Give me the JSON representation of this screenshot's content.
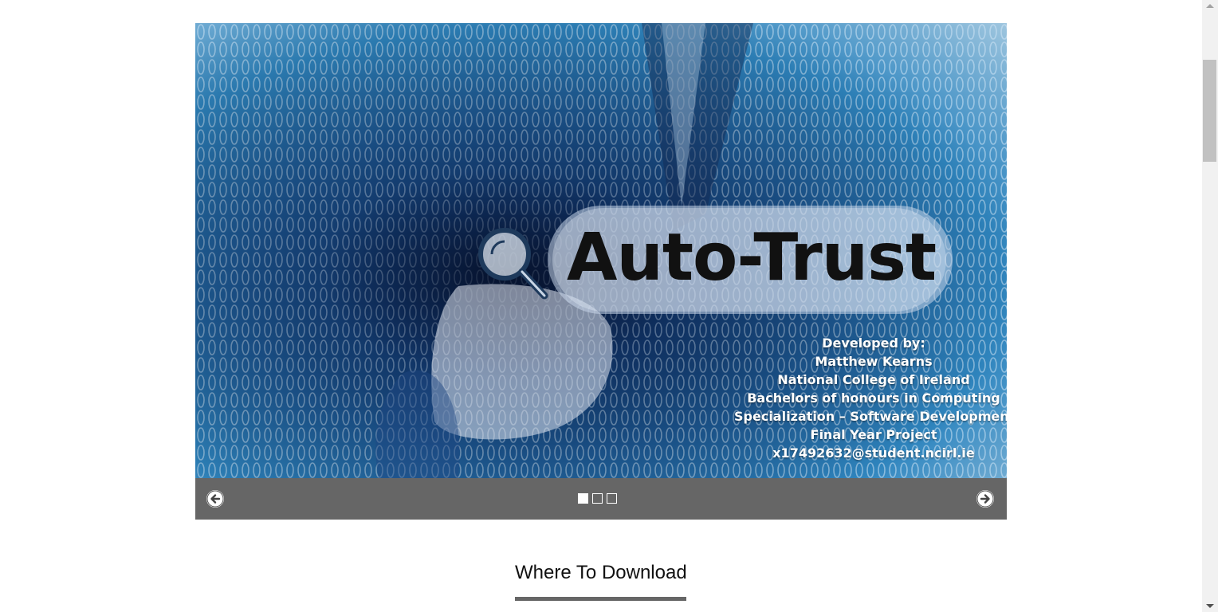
{
  "slideshow": {
    "slide_count": 3,
    "active_index": 0,
    "slide": {
      "logo_text": "Auto-Trust",
      "credits": [
        "Developed by:",
        "Matthew Kearns",
        "National College of Ireland",
        "Bachelors of honours in Computing",
        "Specialization – Software Development",
        "Final Year Project",
        "x17492632@student.ncirl.ie"
      ]
    },
    "prev_icon": "arrow-left-circle-icon",
    "next_icon": "arrow-right-circle-icon",
    "control_bar_color": "#666666"
  },
  "section": {
    "title": "Where To Download"
  },
  "colors": {
    "slide_blue": "#1f5f9c",
    "underline": "#666666"
  }
}
